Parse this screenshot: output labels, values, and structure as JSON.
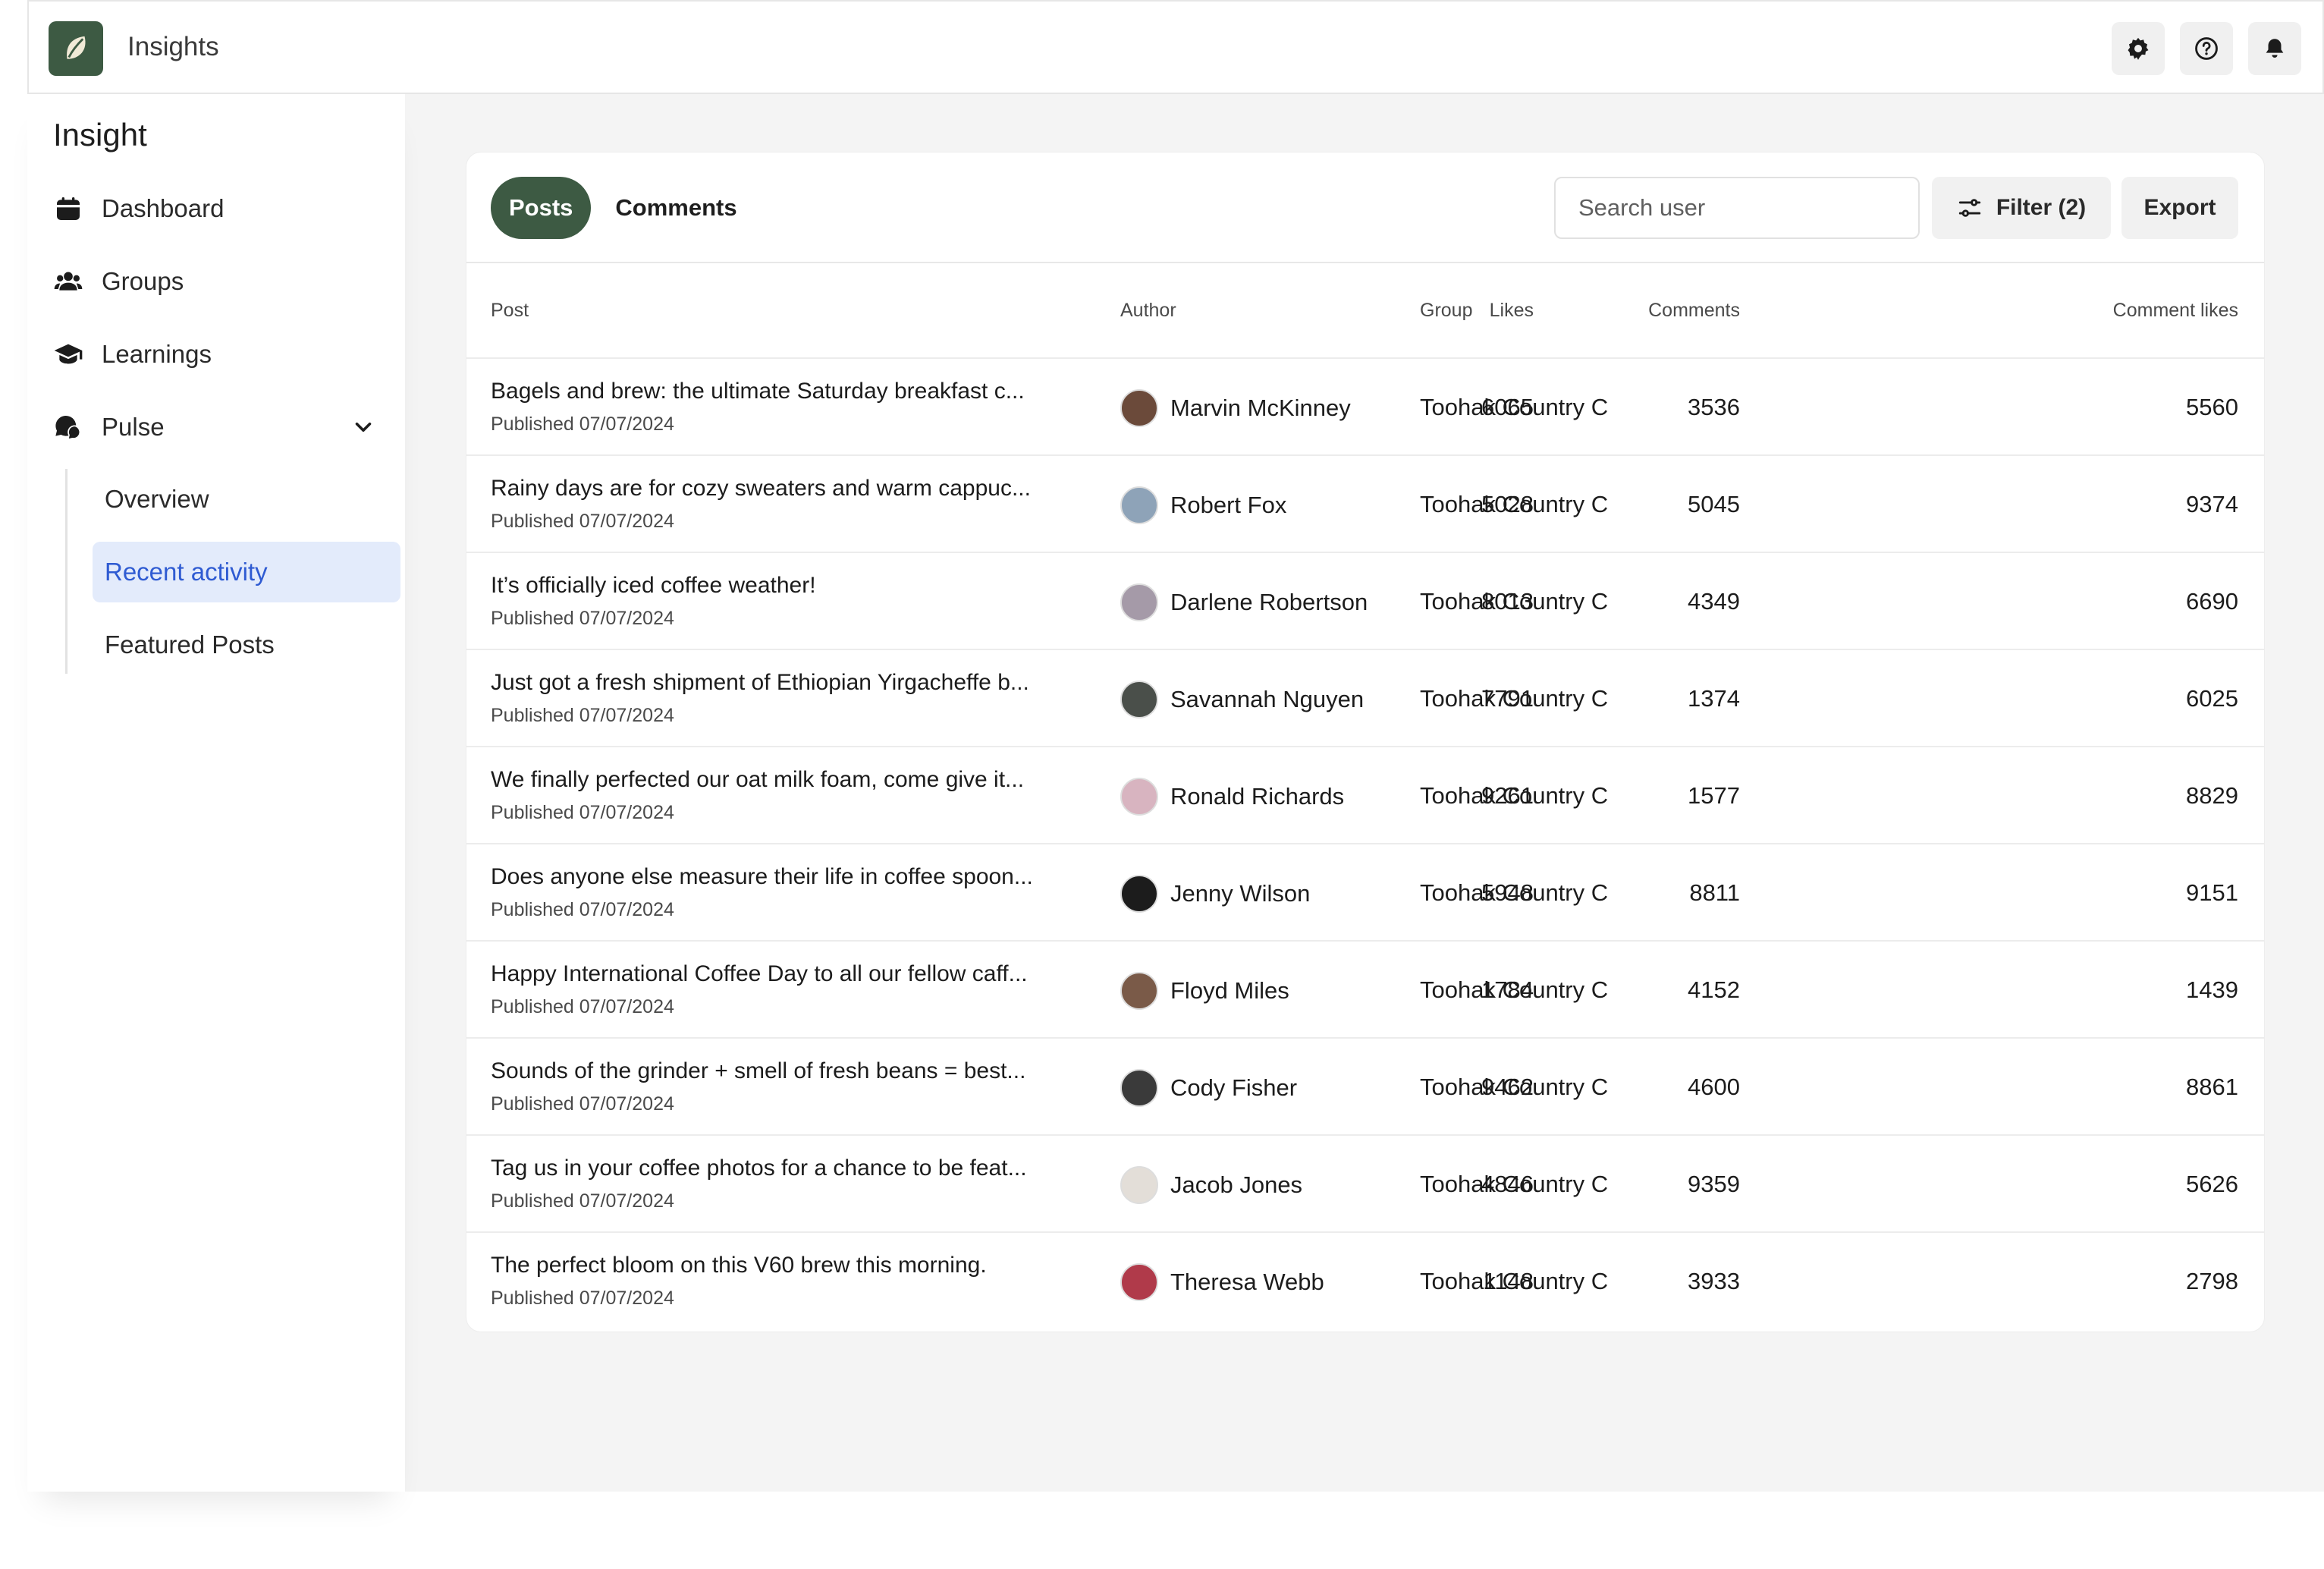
{
  "app": {
    "title": "Insights",
    "brand_color": "#3d5a43",
    "top_actions": [
      "gear-icon",
      "help-icon",
      "bell-icon"
    ]
  },
  "sidebar": {
    "title": "Insight",
    "items": [
      {
        "label": "Dashboard",
        "icon": "calendar-icon"
      },
      {
        "label": "Groups",
        "icon": "users-icon"
      },
      {
        "label": "Learnings",
        "icon": "graduation-cap-icon"
      },
      {
        "label": "Pulse",
        "icon": "chat-bubbles-icon",
        "expanded": true
      }
    ],
    "subitems": [
      {
        "label": "Overview",
        "active": false
      },
      {
        "label": "Recent activity",
        "active": true
      },
      {
        "label": "Featured Posts",
        "active": false
      }
    ]
  },
  "toolbar": {
    "tabs": [
      {
        "label": "Posts",
        "active": true
      },
      {
        "label": "Comments",
        "active": false
      }
    ],
    "search_placeholder": "Search user",
    "filter_label": "Filter (2)",
    "export_label": "Export"
  },
  "table": {
    "headers": {
      "post": "Post",
      "author": "Author",
      "group": "Group",
      "likes": "Likes",
      "comments": "Comments",
      "comment_likes": "Comment likes"
    },
    "rows": [
      {
        "title": "Bagels and brew: the ultimate Saturday breakfast c...",
        "date": "Published 07/07/2024",
        "author": "Marvin McKinney",
        "avatar_color": "#6b4a3a",
        "group": "Toohak Country C",
        "likes": "6065",
        "comments": "3536",
        "comment_likes": "5560"
      },
      {
        "title": "Rainy days are for cozy sweaters and warm cappuc...",
        "date": "Published 07/07/2024",
        "author": "Robert Fox",
        "avatar_color": "#8ea3b8",
        "group": "Toohak Country C",
        "likes": "5028",
        "comments": "5045",
        "comment_likes": "9374"
      },
      {
        "title": "It’s officially iced coffee weather!",
        "date": "Published 07/07/2024",
        "author": "Darlene Robertson",
        "avatar_color": "#a59aa8",
        "group": "Toohak Country C",
        "likes": "8013",
        "comments": "4349",
        "comment_likes": "6690"
      },
      {
        "title": "Just got a fresh shipment of Ethiopian Yirgacheffe b...",
        "date": "Published 07/07/2024",
        "author": "Savannah Nguyen",
        "avatar_color": "#4a4f4a",
        "group": "Toohak Country C",
        "likes": "7791",
        "comments": "1374",
        "comment_likes": "6025"
      },
      {
        "title": "We finally perfected our oat milk foam, come give it...",
        "date": "Published 07/07/2024",
        "author": "Ronald Richards",
        "avatar_color": "#d8b4c0",
        "group": "Toohak Country C",
        "likes": "9261",
        "comments": "1577",
        "comment_likes": "8829"
      },
      {
        "title": "Does anyone else measure their life in coffee spoon...",
        "date": "Published 07/07/2024",
        "author": "Jenny Wilson",
        "avatar_color": "#1c1c1c",
        "group": "Toohak Country C",
        "likes": "5948",
        "comments": "8811",
        "comment_likes": "9151"
      },
      {
        "title": "Happy International Coffee Day to all our fellow caff...",
        "date": "Published 07/07/2024",
        "author": "Floyd Miles",
        "avatar_color": "#7a5a48",
        "group": "Toohak Country C",
        "likes": "1784",
        "comments": "4152",
        "comment_likes": "1439"
      },
      {
        "title": "Sounds of the grinder + smell of fresh beans = best...",
        "date": "Published 07/07/2024",
        "author": "Cody Fisher",
        "avatar_color": "#3a3a3a",
        "group": "Toohak Country C",
        "likes": "9462",
        "comments": "4600",
        "comment_likes": "8861"
      },
      {
        "title": "Tag us in your coffee photos for a chance to be feat...",
        "date": "Published 07/07/2024",
        "author": "Jacob Jones",
        "avatar_color": "#e3ded8",
        "group": "Toohak Country C",
        "likes": "4846",
        "comments": "9359",
        "comment_likes": "5626"
      },
      {
        "title": "The perfect bloom on this V60 brew this morning.",
        "date": "Published 07/07/2024",
        "author": "Theresa Webb",
        "avatar_color": "#b03a4a",
        "group": "Toohak Country C",
        "likes": "1148",
        "comments": "3933",
        "comment_likes": "2798"
      }
    ]
  }
}
